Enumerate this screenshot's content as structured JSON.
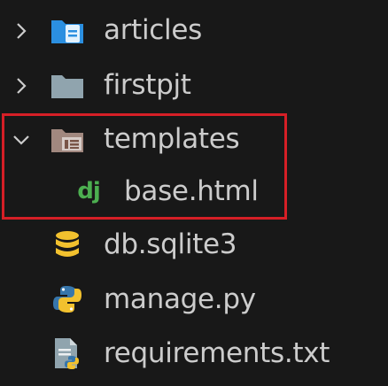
{
  "explorer": {
    "items": [
      {
        "label": "articles",
        "kind": "folder",
        "expanded": false,
        "icon": "folder-docs-icon",
        "icon_color": "#2b8fe0"
      },
      {
        "label": "firstpjt",
        "kind": "folder",
        "expanded": false,
        "icon": "folder-icon",
        "icon_color": "#90a4ae"
      },
      {
        "label": "templates",
        "kind": "folder",
        "expanded": true,
        "icon": "folder-open-template-icon",
        "icon_color": "#a1887f"
      },
      {
        "label": "base.html",
        "kind": "file",
        "icon": "django-icon",
        "icon_color": "#4caf50",
        "icon_text": "dj"
      },
      {
        "label": "db.sqlite3",
        "kind": "file",
        "icon": "database-icon",
        "icon_color": "#f2c12e"
      },
      {
        "label": "manage.py",
        "kind": "file",
        "icon": "python-icon",
        "icon_color": "#3776ab"
      },
      {
        "label": "requirements.txt",
        "kind": "file",
        "icon": "requirements-file-icon",
        "icon_color": "#90a4ae"
      }
    ]
  },
  "highlight": {
    "color": "#d61f26"
  }
}
